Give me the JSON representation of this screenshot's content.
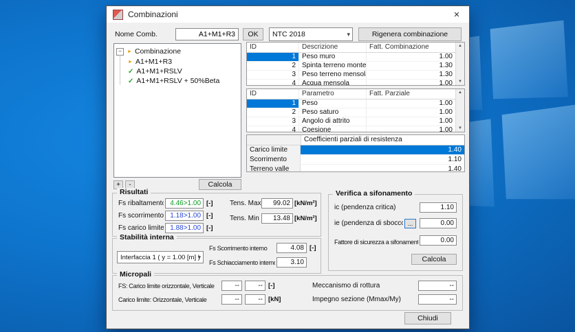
{
  "window": {
    "title": "Combinazioni",
    "close": "✕"
  },
  "icons": {
    "collapse": "−",
    "bullet": "►",
    "check": "✓",
    "up": "▲",
    "down": "▼",
    "combo_arrow": "▾"
  },
  "header": {
    "name_label": "Nome Comb.",
    "name_value": "A1+M1+R3",
    "ok": "OK",
    "code": "NTC 2018",
    "regen": "Rigenera combinazione"
  },
  "tree": {
    "root": "Combinazione",
    "items": [
      {
        "label": "A1+M1+R3"
      },
      {
        "label": "A1+M1+RSLV"
      },
      {
        "label": "A1+M1+RSLV + 50%Beta"
      }
    ],
    "add": "+",
    "remove": "-",
    "calcola": "Calcola"
  },
  "table1": {
    "h": [
      "ID",
      "Descrizione",
      "Fatt. Combinazione"
    ],
    "rows": [
      [
        "1",
        "Peso muro",
        "1.00"
      ],
      [
        "2",
        "Spinta terreno monte",
        "1.30"
      ],
      [
        "3",
        "Peso terreno mensola",
        "1.30"
      ],
      [
        "4",
        "Acqua mensola",
        "1.00"
      ]
    ]
  },
  "table2": {
    "h": [
      "ID",
      "Parametro",
      "Fatt. Parziale"
    ],
    "rows": [
      [
        "1",
        "Peso",
        "1.00"
      ],
      [
        "2",
        "Peso saturo",
        "1.00"
      ],
      [
        "3",
        "Angolo di attrito",
        "1.00"
      ],
      [
        "4",
        "Coesione",
        "1.00"
      ]
    ]
  },
  "table3": {
    "header": "Coefficienti parziali di resistenza",
    "rows": [
      [
        "Carico limite",
        "1.40"
      ],
      [
        "Scorrimento",
        "1.10"
      ],
      [
        "Terreno valle",
        "1.40"
      ]
    ]
  },
  "risultati": {
    "title": "Risultati",
    "fs": [
      {
        "label": "Fs ribaltamento",
        "value": "4.46>1.00",
        "unit": "[-]"
      },
      {
        "label": "Fs scorrimento",
        "value": "1.18>1.00",
        "unit": "[-]"
      },
      {
        "label": "Fs carico limite",
        "value": "1.88>1.00",
        "unit": "[-]"
      }
    ],
    "tens": [
      {
        "label": "Tens. Max",
        "value": "99.02",
        "unit": "[kN/m²]"
      },
      {
        "label": "Tens. Min",
        "value": "13.48",
        "unit": "[kN/m²]"
      }
    ]
  },
  "stabilita": {
    "title": "Stabilità interna",
    "combo": "Interfaccia 1 ( y = 1.00 [m] )",
    "rows": [
      {
        "label": "Fs Scorrimento interno",
        "value": "4.08",
        "unit": "[-]"
      },
      {
        "label": "Fs Schiacciamento interno",
        "value": "3.10",
        "unit": ""
      }
    ]
  },
  "sifonamento": {
    "title": "Verifica a sifonamento",
    "ic_label": "ic (pendenza critica)",
    "ic_value": "1.10",
    "ie_label": "ie (pendenza di sbocco)",
    "browse": "...",
    "ie_value": "0.00",
    "fattore_label": "Fattore di sicurezza a sifonamento",
    "fattore_value": "0.00",
    "calcola": "Calcola"
  },
  "micropali": {
    "title": "Micropali",
    "r1_label": "FS: Carico limite orizzontale, Verticale",
    "r1_v1": "--",
    "r1_v2": "--",
    "r1_unit": "[-]",
    "r2_label": "Carico limite: Orizzontale, Verticale",
    "r2_v1": "--",
    "r2_v2": "--",
    "r2_unit": "[kN]",
    "mec_label": "Meccanismo di rottura",
    "mec_value": "--",
    "imp_label": "Impegno sezione (Mmax/My)",
    "imp_value": "--"
  },
  "footer": {
    "chiudi": "Chiudi"
  },
  "colors": {
    "accent": "#0078d7",
    "pass_green": "#0a9a22",
    "pass_blue": "#2746d8",
    "desktop_blue": "#0d74cf"
  }
}
